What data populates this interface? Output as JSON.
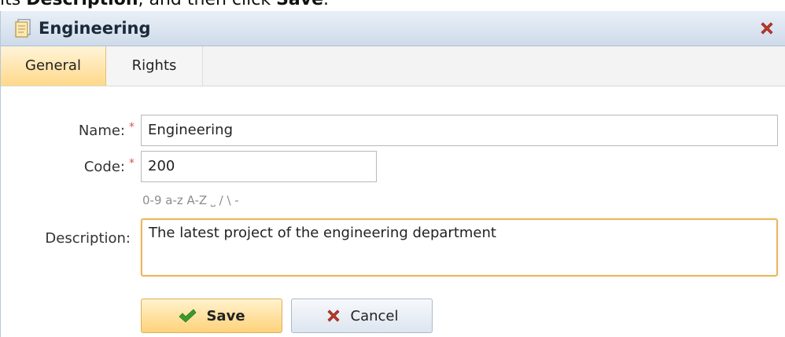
{
  "instruction": {
    "prefix": "its ",
    "bold1": "Description",
    "middle": ", and then click ",
    "bold2": "Save",
    "suffix": "."
  },
  "dialog": {
    "title": "Engineering",
    "icons": {
      "title_icon": "document-icon",
      "close_icon": "close-icon"
    },
    "accent_colors": {
      "active_tab": "#ffd98a",
      "focus_border": "#e8b760",
      "required": "#d9534f",
      "close": "#c0392b"
    }
  },
  "tabs": [
    {
      "label": "General",
      "active": true
    },
    {
      "label": "Rights",
      "active": false
    }
  ],
  "form": {
    "name_label": "Name:",
    "name_value": "Engineering",
    "code_label": "Code:",
    "code_value": "200",
    "code_hint": "0-9 a-z A-Z ˽ / \\ -",
    "required_marker": "*",
    "description_label": "Description:",
    "description_value": "The latest project of the engineering department"
  },
  "buttons": {
    "save_label": "Save",
    "cancel_label": "Cancel",
    "save_icon": "checkmark-icon",
    "cancel_icon": "x-icon"
  }
}
